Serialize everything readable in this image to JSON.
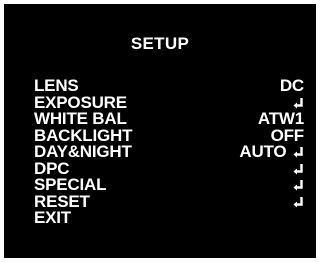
{
  "osd": {
    "title": "SETUP",
    "items": [
      {
        "label": "LENS",
        "value": "DC",
        "has_enter_icon": false
      },
      {
        "label": "EXPOSURE",
        "value": "",
        "has_enter_icon": true
      },
      {
        "label": "WHITE BAL",
        "value": "ATW1",
        "has_enter_icon": false
      },
      {
        "label": "BACKLIGHT",
        "value": "OFF",
        "has_enter_icon": false
      },
      {
        "label": "DAY&NIGHT",
        "value": "AUTO",
        "has_enter_icon": true
      },
      {
        "label": "DPC",
        "value": "",
        "has_enter_icon": true
      },
      {
        "label": "SPECIAL",
        "value": "",
        "has_enter_icon": true
      },
      {
        "label": "RESET",
        "value": "",
        "has_enter_icon": true
      },
      {
        "label": "EXIT",
        "value": "",
        "has_enter_icon": false
      }
    ],
    "icon": "enter-return-icon",
    "colors": {
      "background": "#000000",
      "text": "#ffffff"
    }
  }
}
